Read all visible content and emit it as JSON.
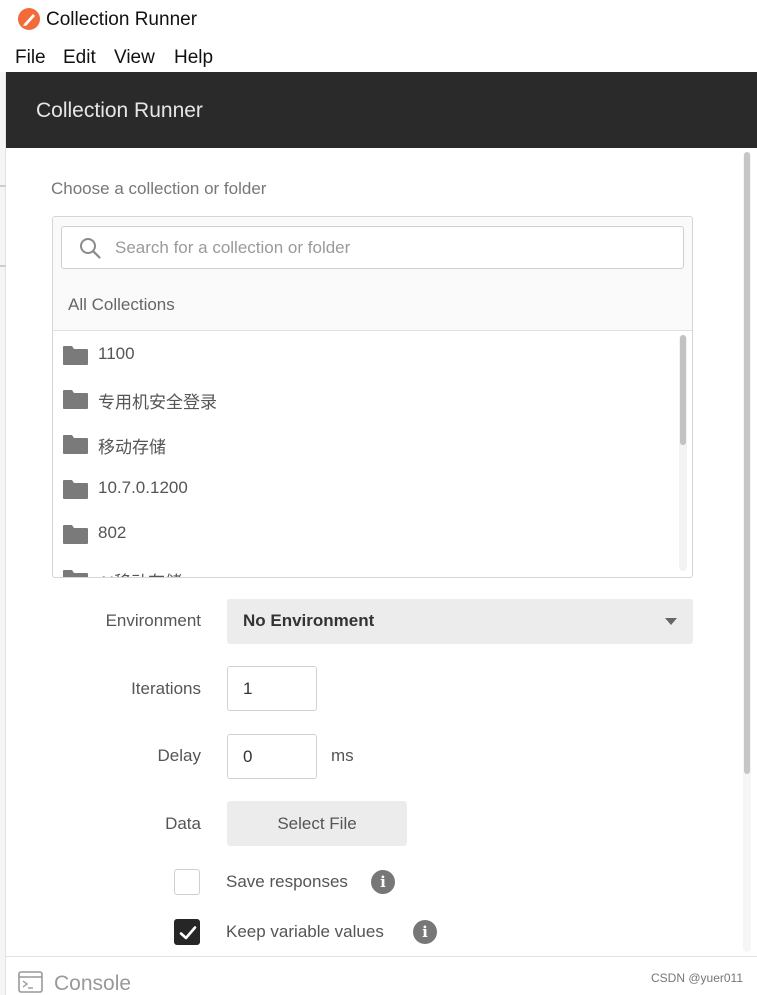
{
  "window": {
    "title": "Collection Runner",
    "menu": [
      "File",
      "Edit",
      "View",
      "Help"
    ]
  },
  "header": {
    "title": "Collection Runner"
  },
  "chooser": {
    "label": "Choose a collection or folder",
    "search_placeholder": "Search for a collection or folder",
    "all_collections_label": "All Collections",
    "items": [
      "1100",
      "专用机安全登录",
      "移动存储",
      "10.7.0.1200",
      "802",
      "AI移动存储"
    ]
  },
  "form": {
    "environment_label": "Environment",
    "environment_value": "No Environment",
    "iterations_label": "Iterations",
    "iterations_value": "1",
    "delay_label": "Delay",
    "delay_value": "0",
    "delay_unit": "ms",
    "data_label": "Data",
    "select_file_label": "Select File",
    "save_responses_label": "Save responses",
    "save_responses_checked": false,
    "keep_variable_values_label": "Keep variable values",
    "keep_variable_values_checked": true,
    "info_glyph": "i"
  },
  "footer": {
    "console_label": "Console",
    "watermark": "CSDN @yuer011"
  },
  "colors": {
    "header_bg": "#2a2a2a",
    "logo": "#f26b3a",
    "checkbox_checked": "#262626"
  },
  "icons": {
    "logo": "postman-logo-icon",
    "search": "search-icon",
    "folder": "folder-icon",
    "caret": "caret-down-icon",
    "info": "info-icon",
    "check": "checkmark-icon",
    "console": "console-icon"
  }
}
